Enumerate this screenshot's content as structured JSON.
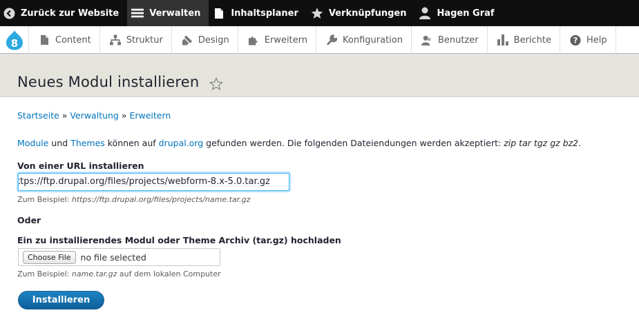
{
  "toolbar": {
    "back_label": "Zurück zur Website",
    "manage_label": "Verwalten",
    "shortcuts_planner_label": "Inhaltsplaner",
    "shortcuts_label": "Verknüpfungen",
    "user_label": "Hagen Graf"
  },
  "tray": {
    "items": [
      {
        "label": "Content",
        "icon": "file-icon"
      },
      {
        "label": "Struktur",
        "icon": "sitemap-icon"
      },
      {
        "label": "Design",
        "icon": "paintbrush-icon"
      },
      {
        "label": "Erweitern",
        "icon": "puzzle-icon"
      },
      {
        "label": "Konfiguration",
        "icon": "wrench-icon"
      },
      {
        "label": "Benutzer",
        "icon": "people-icon"
      },
      {
        "label": "Berichte",
        "icon": "bar-chart-icon"
      },
      {
        "label": "Help",
        "icon": "help-icon"
      }
    ]
  },
  "page": {
    "title": "Neues Modul installieren"
  },
  "breadcrumb": {
    "home": "Startseite",
    "sep1": " » ",
    "admin": "Verwaltung",
    "sep2": " » ",
    "extend": "Erweitern"
  },
  "intro": {
    "link_modules": "Module",
    "and": " und ",
    "link_themes": "Themes",
    "text1": " können auf ",
    "link_drupal": "drupal.org",
    "text2": " gefunden werden. Die folgenden Dateiendungen werden akzeptiert: ",
    "extensions": "zip tar tgz gz bz2",
    "end": "."
  },
  "form": {
    "url_label": "Von einer URL installieren",
    "url_value": "ttps://ftp.drupal.org/files/projects/webform-8.x-5.0.tar.gz",
    "url_desc_prefix": "Zum Beispiel: ",
    "url_desc_example": "https://ftp.drupal.org/files/projects/name.tar.gz",
    "or_label": "Oder",
    "upload_label": "Ein zu installierendes Modul oder Theme Archiv (tar.gz) hochladen",
    "choose_file": "Choose File",
    "no_file": "no file selected",
    "upload_desc_prefix": "Zum Beispiel: ",
    "upload_desc_example": "name.tar.gz",
    "upload_desc_suffix": " auf dem lokalen Computer",
    "submit_label": "Installieren"
  },
  "colors": {
    "link": "#0074bd",
    "toolbar_bg": "#0f0f0f",
    "title_bg": "#e5e4dc",
    "button": "#0c5e99"
  }
}
